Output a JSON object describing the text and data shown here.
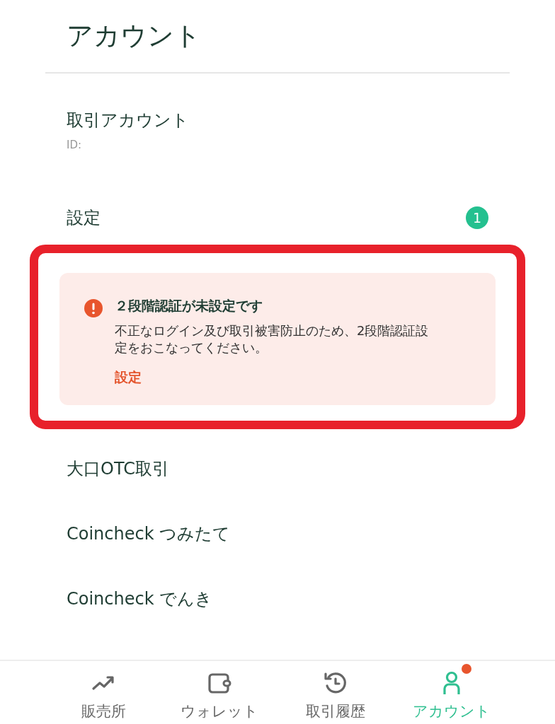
{
  "header": {
    "title": "アカウント"
  },
  "account": {
    "title": "取引アカウント",
    "id_label": "ID:"
  },
  "settings": {
    "label": "設定",
    "badge": "1"
  },
  "alert": {
    "highlighted": true,
    "title": "２段階認証が未設定です",
    "message": "不正なログイン及び取引被害防止のため、2段階認証設定をおこなってください。",
    "action": "設定"
  },
  "menu_items": [
    {
      "label": "大口OTC取引"
    },
    {
      "label": "Coincheck つみたて"
    },
    {
      "label": "Coincheck でんき"
    }
  ],
  "tab_bar": [
    {
      "kind": "chart",
      "label": "販売所",
      "selected": false,
      "dot": false
    },
    {
      "kind": "wallet",
      "label": "ウォレット",
      "selected": false,
      "dot": false
    },
    {
      "kind": "history",
      "label": "取引履歴",
      "selected": false,
      "dot": false
    },
    {
      "kind": "person",
      "label": "アカウント",
      "selected": true,
      "dot": true
    }
  ]
}
